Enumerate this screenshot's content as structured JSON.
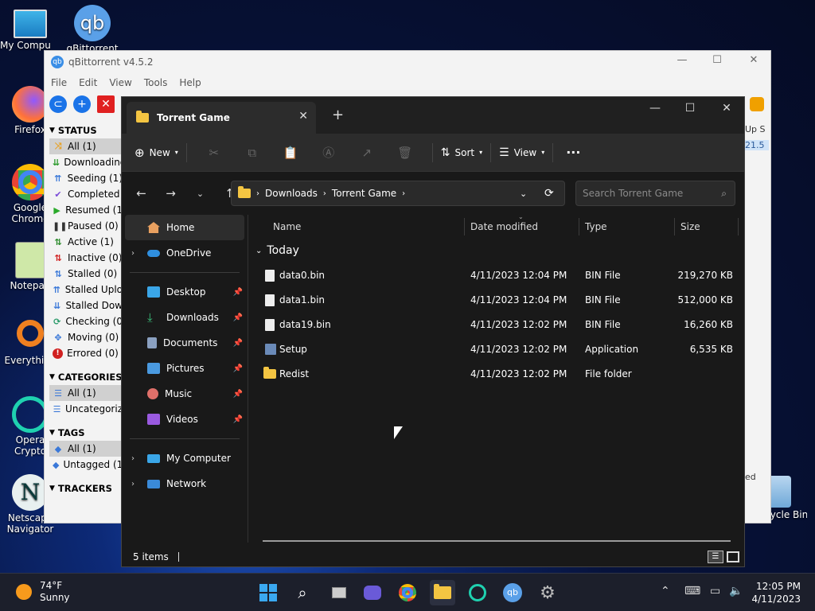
{
  "desktop": {
    "icons": [
      "My Computer",
      "qBittorrent",
      "Firefox",
      "Google Chrome",
      "Notepad",
      "Everything",
      "Opera Crypto Browser",
      "Netscape Navigator",
      "Recycle Bin"
    ]
  },
  "qbt": {
    "title": "qBittorrent v4.5.2",
    "menu": [
      "File",
      "Edit",
      "View",
      "Tools",
      "Help"
    ],
    "status_header": "STATUS",
    "status_items": [
      "All (1)",
      "Downloading",
      "Seeding (1)",
      "Completed",
      "Resumed (1",
      "Paused (0)",
      "Active (1)",
      "Inactive (0)",
      "Stalled (0)",
      "Stalled Uplo",
      "Stalled Dow",
      "Checking (0",
      "Moving (0)",
      "Errored (0)"
    ],
    "categories_header": "CATEGORIES",
    "categories_items": [
      "All (1)",
      "Uncategoriz"
    ],
    "tags_header": "TAGS",
    "tags_items": [
      "All (1)",
      "Untagged (1"
    ],
    "trackers_header": "TRACKERS",
    "right_col_header": "Up S",
    "right_col_value": "21.5",
    "right_col_bottom": "ed"
  },
  "explorer": {
    "tab_title": "Torrent Game",
    "new_label": "New",
    "sort_label": "Sort",
    "view_label": "View",
    "more_label": "···",
    "path": [
      "Downloads",
      "Torrent Game"
    ],
    "search_placeholder": "Search Torrent Game",
    "nav_top": [
      "Home",
      "OneDrive"
    ],
    "nav_pinned": [
      "Desktop",
      "Downloads",
      "Documents",
      "Pictures",
      "Music",
      "Videos"
    ],
    "nav_bottom": [
      "My Computer",
      "Network"
    ],
    "columns": [
      "Name",
      "Date modified",
      "Type",
      "Size"
    ],
    "group_label": "Today",
    "files": [
      {
        "name": "data0.bin",
        "date": "4/11/2023 12:04 PM",
        "type": "BIN File",
        "size": "219,270 KB"
      },
      {
        "name": "data1.bin",
        "date": "4/11/2023 12:04 PM",
        "type": "BIN File",
        "size": "512,000 KB"
      },
      {
        "name": "data19.bin",
        "date": "4/11/2023 12:02 PM",
        "type": "BIN File",
        "size": "16,260 KB"
      },
      {
        "name": "Setup",
        "date": "4/11/2023 12:02 PM",
        "type": "Application",
        "size": "6,535 KB"
      },
      {
        "name": "Redist",
        "date": "4/11/2023 12:02 PM",
        "type": "File folder",
        "size": ""
      }
    ],
    "status_text": "5 items"
  },
  "taskbar": {
    "temp": "74°F",
    "weather": "Sunny",
    "time": "12:05 PM",
    "date": "4/11/2023"
  }
}
